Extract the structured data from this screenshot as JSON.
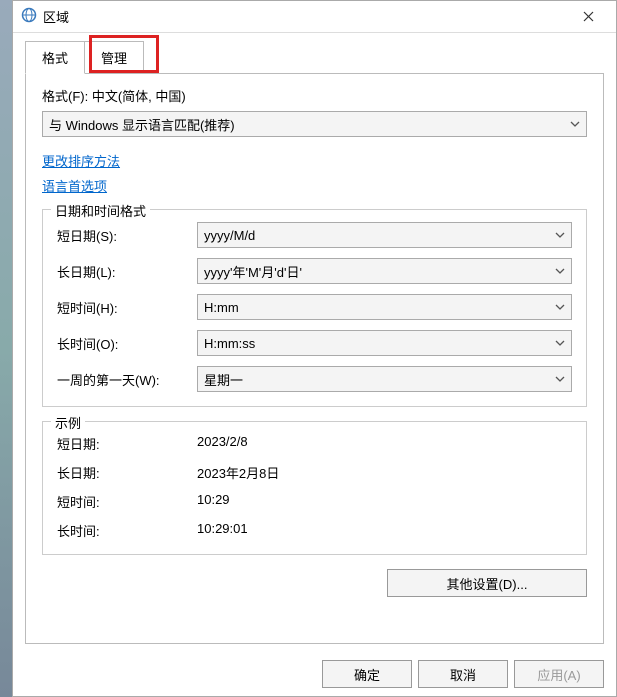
{
  "window": {
    "title": "区域"
  },
  "tabs": {
    "format": "格式",
    "admin": "管理"
  },
  "format_section": {
    "label": "格式(F): 中文(简体, 中国)",
    "combo_value": "与 Windows 显示语言匹配(推荐)"
  },
  "links": {
    "sort_method": "更改排序方法",
    "lang_pref": "语言首选项"
  },
  "datetime_group": {
    "title": "日期和时间格式",
    "short_date_label": "短日期(S):",
    "short_date_value": "yyyy/M/d",
    "long_date_label": "长日期(L):",
    "long_date_value": "yyyy'年'M'月'd'日'",
    "short_time_label": "短时间(H):",
    "short_time_value": "H:mm",
    "long_time_label": "长时间(O):",
    "long_time_value": "H:mm:ss",
    "first_day_label": "一周的第一天(W):",
    "first_day_value": "星期一"
  },
  "example_group": {
    "title": "示例",
    "short_date_label": "短日期:",
    "short_date_value": "2023/2/8",
    "long_date_label": "长日期:",
    "long_date_value": "2023年2月8日",
    "short_time_label": "短时间:",
    "short_time_value": "10:29",
    "long_time_label": "长时间:",
    "long_time_value": "10:29:01"
  },
  "buttons": {
    "other_settings": "其他设置(D)...",
    "ok": "确定",
    "cancel": "取消",
    "apply": "应用(A)"
  }
}
